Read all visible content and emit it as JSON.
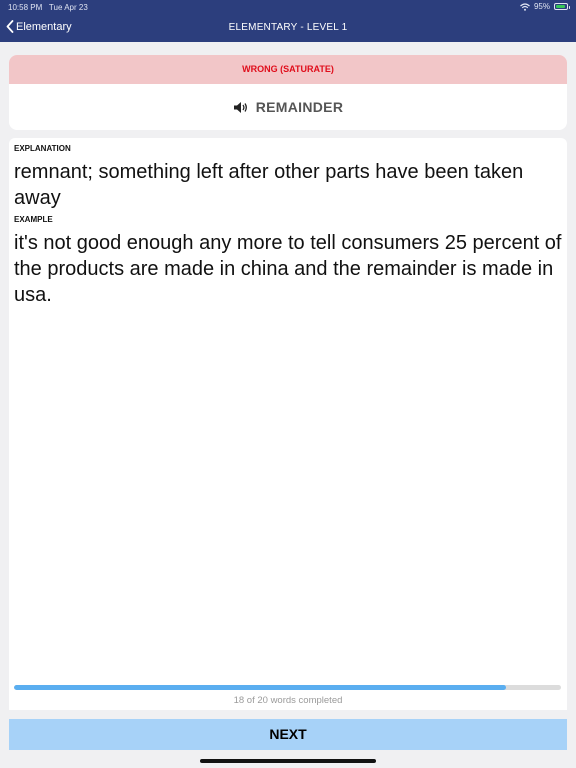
{
  "status_bar": {
    "time": "10:58 PM",
    "date": "Tue Apr 23",
    "battery_percent": "95%",
    "icons": [
      "wifi-icon",
      "battery-icon"
    ],
    "battery_color": "#35c759"
  },
  "navbar": {
    "back_label": "Elementary",
    "title": "ELEMENTARY - LEVEL 1",
    "background_color": "#2c3e7d"
  },
  "result": {
    "label": "WRONG (SATURATE)",
    "text_color": "#e00d1b",
    "background_color": "#f2c6c8"
  },
  "word": {
    "text": "REMAINDER",
    "icon": "speaker-icon"
  },
  "explanation": {
    "label": "EXPLANATION",
    "text": "remnant; something left after other parts have been taken away"
  },
  "example": {
    "label": "EXAMPLE",
    "text": "it's not good enough any more to tell consumers 25 percent of the products are made in china and the remainder is made in usa."
  },
  "progress": {
    "completed": 18,
    "total": 20,
    "text": "18 of 20 words completed",
    "fill_color": "#5aaef0"
  },
  "next_button": {
    "label": "NEXT",
    "background_color": "#a7d2f8"
  }
}
